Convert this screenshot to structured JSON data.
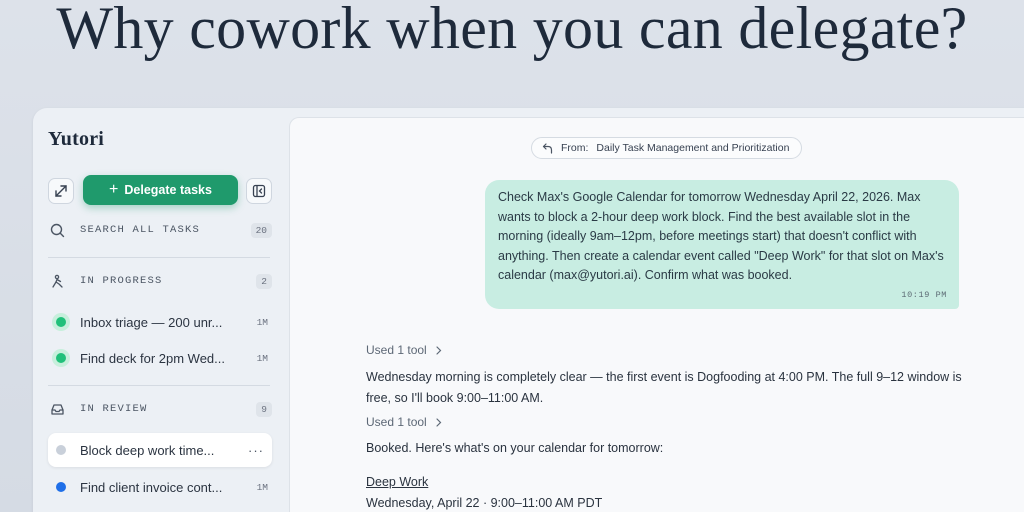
{
  "headline": "Why cowork when you can delegate?",
  "app": {
    "brand": "Yutori",
    "delegate_label": "Delegate tasks",
    "search": {
      "label": "SEARCH ALL TASKS",
      "count": "20"
    },
    "in_progress": {
      "label": "IN PROGRESS",
      "count": "2",
      "tasks": [
        {
          "title": "Inbox triage — 200 unr...",
          "time": "1M"
        },
        {
          "title": "Find deck for 2pm Wed...",
          "time": "1M"
        }
      ]
    },
    "in_review": {
      "label": "IN REVIEW",
      "count": "9",
      "tasks": [
        {
          "title": "Block deep work time...",
          "more": "···"
        },
        {
          "title": "Find client invoice cont...",
          "time": "1M"
        }
      ]
    }
  },
  "chat": {
    "from_prefix": "From:",
    "from_source": "Daily Task Management and Prioritization",
    "user_message": "Check Max's Google Calendar for tomorrow Wednesday April 22, 2026. Max wants to block a 2-hour deep work block. Find the best available slot in the morning (ideally 9am–12pm, before meetings start) that doesn't conflict with anything. Then create a calendar event called \"Deep Work\" for that slot on Max's calendar (max@yutori.ai). Confirm what was booked.",
    "user_time": "10:19 PM",
    "tool_1": "Used 1 tool",
    "reply_1": "Wednesday morning is completely clear — the first event is Dogfooding at 4:00 PM. The full 9–12 window is free, so I'll book 9:00–11:00 AM.",
    "tool_2": "Used 1 tool",
    "reply_2": "Booked. Here's what's on your calendar for tomorrow:",
    "event_title": "Deep Work",
    "event_when": "Wednesday, April 22 · 9:00–11:00 AM PDT"
  },
  "colors": {
    "accent_green": "#1f9a6c",
    "bubble": "#c8ede2",
    "status_in_progress": "#21c07a",
    "status_blue": "#1f6fe8"
  }
}
